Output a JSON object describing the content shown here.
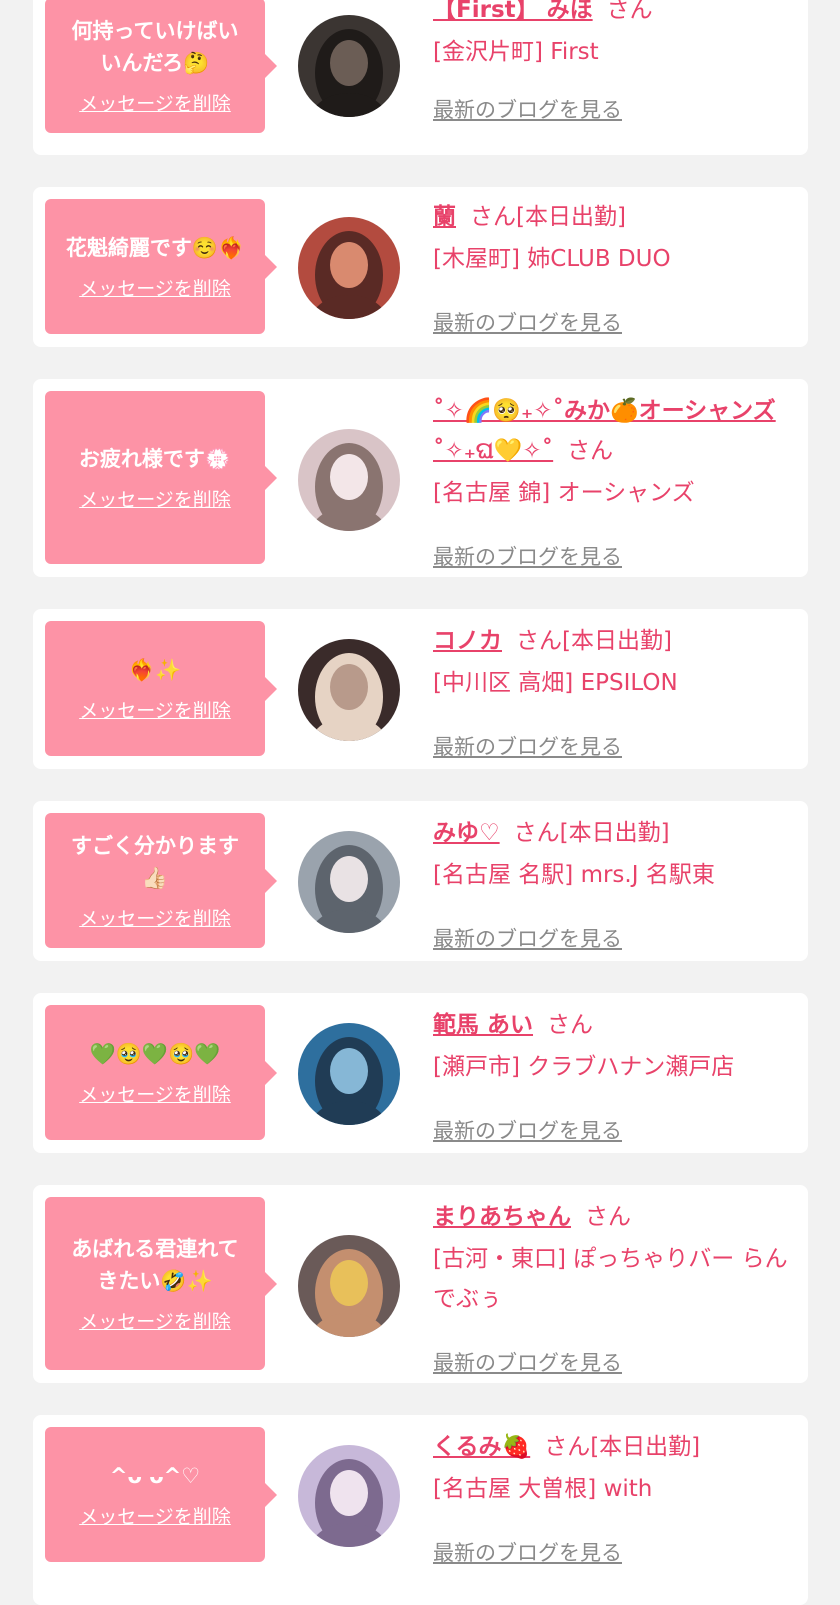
{
  "delete_label": "メッセージを削除",
  "blog_label": "最新のブログを見る",
  "colors": {
    "background": "#f2f2f2",
    "card": "#ffffff",
    "bubble": "#fd93a6",
    "accent": "#e8426a",
    "link_gray": "#8a8a8a"
  },
  "messages": [
    {
      "bubble_text": "何持っていけばい\nいんだろ🤔",
      "name": "【First】 みほ",
      "suffix": "さん",
      "store": "[金沢片町] First",
      "avatar_icon": "avatar-photo"
    },
    {
      "bubble_text": "花魁綺麗です☺️❤️‍🔥",
      "name": "蘭",
      "suffix": "さん[本日出勤]",
      "store": "[木屋町] 姉CLUB DUO",
      "avatar_icon": "avatar-photo"
    },
    {
      "bubble_text": "お疲れ様です💮",
      "name": "˚✧🌈🥺₊✧˚みか🍊オーシャンズ˚✧₊ଘ💛✧˚",
      "suffix": "さん",
      "store": "[名古屋 錦] オーシャンズ",
      "avatar_icon": "avatar-photo"
    },
    {
      "bubble_text": "❤️‍🔥✨",
      "name": "コノカ",
      "suffix": "さん[本日出勤]",
      "store": "[中川区 高畑] EPSILON",
      "avatar_icon": "avatar-photo"
    },
    {
      "bubble_text": "すごく分かります\n👍🏻",
      "name": "みゆ♡",
      "suffix": "さん[本日出勤]",
      "store": "[名古屋 名駅] mrs.J 名駅東",
      "avatar_icon": "avatar-photo"
    },
    {
      "bubble_text": "💚🥹💚🥹💚",
      "name": "範馬 あい",
      "suffix": "さん",
      "store": "[瀬戸市] クラブハナン瀬戸店",
      "avatar_icon": "avatar-photo"
    },
    {
      "bubble_text": "あばれる君連れて\nきたい🤣✨",
      "name": "まりあちゃん",
      "suffix": "さん",
      "store": "[古河・東口] ぽっちゃりバー らんでぶぅ",
      "avatar_icon": "avatar-photo"
    },
    {
      "bubble_text": "^ᴗ ᴗ^♡",
      "name": "くるみ🍓",
      "suffix": "さん[本日出勤]",
      "store": "[名古屋 大曽根] with",
      "avatar_icon": "avatar-photo"
    }
  ]
}
